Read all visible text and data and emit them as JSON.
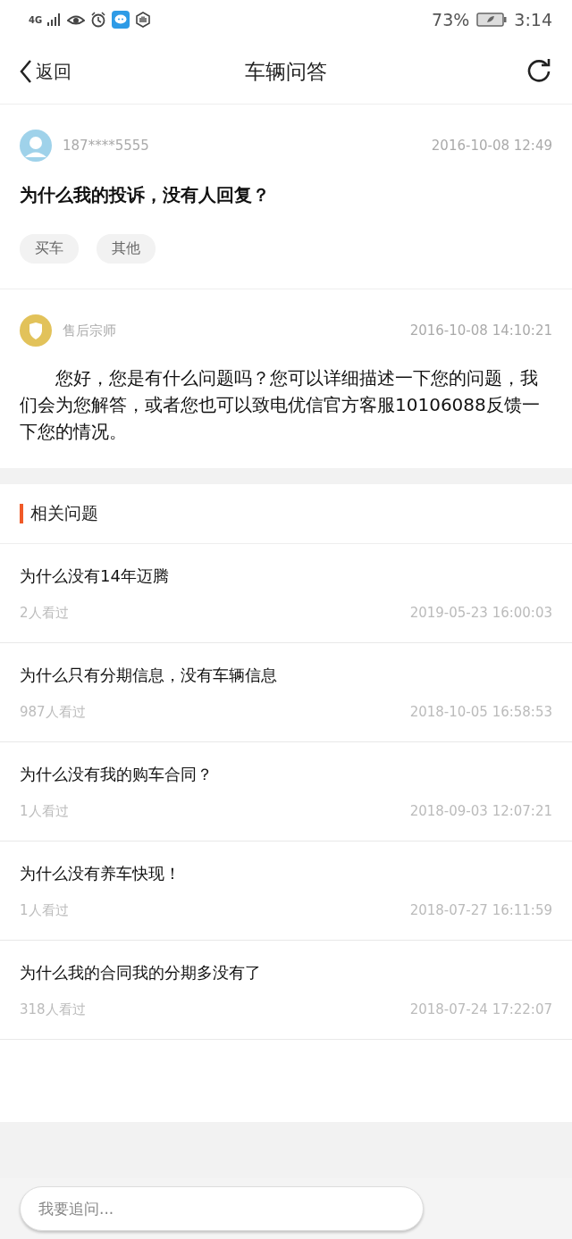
{
  "status_bar": {
    "network": "4G",
    "battery_percent": "73%",
    "time": "3:14"
  },
  "nav": {
    "back": "返回",
    "title": "车辆问答"
  },
  "question": {
    "user": "187****5555",
    "time": "2016-10-08 12:49",
    "title": "为什么我的投诉，没有人回复？",
    "tags": [
      "买车",
      "其他"
    ]
  },
  "answer": {
    "author": "售后宗师",
    "time": "2016-10-08 14:10:21",
    "text": "您好，您是有什么问题吗？您可以详细描述一下您的问题，我们会为您解答，或者您也可以致电优信官方客服10106088反馈一下您的情况。"
  },
  "related": {
    "title": "相关问题",
    "items": [
      {
        "title": "为什么没有14年迈腾",
        "views": "2人看过",
        "time": "2019-05-23 16:00:03"
      },
      {
        "title": "为什么只有分期信息，没有车辆信息",
        "views": "987人看过",
        "time": "2018-10-05 16:58:53"
      },
      {
        "title": "为什么没有我的购车合同？",
        "views": "1人看过",
        "time": "2018-09-03 12:07:21"
      },
      {
        "title": "为什么没有养车快现！",
        "views": "1人看过",
        "time": "2018-07-27 16:11:59"
      },
      {
        "title": "为什么我的合同我的分期多没有了",
        "views": "318人看过",
        "time": "2018-07-24 17:22:07"
      }
    ]
  },
  "input": {
    "placeholder": "我要追问..."
  }
}
